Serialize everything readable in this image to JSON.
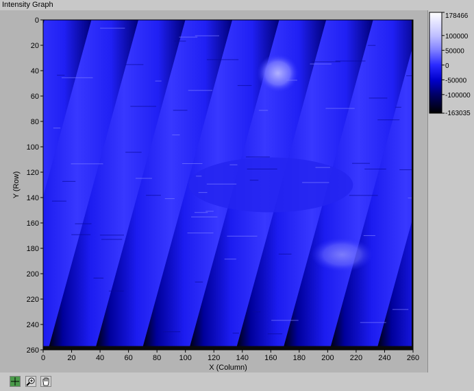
{
  "window": {
    "title": "Intensity Graph"
  },
  "chart_data": {
    "type": "heatmap",
    "title": "Intensity Graph",
    "xlabel": "X (Column)",
    "ylabel": "Y (Row)",
    "xlim": [
      0,
      260
    ],
    "ylim": [
      0,
      260
    ],
    "y_inverted": true,
    "x_ticks": [
      0,
      20,
      40,
      60,
      80,
      100,
      120,
      140,
      160,
      180,
      200,
      220,
      240,
      260
    ],
    "y_ticks": [
      0,
      20,
      40,
      60,
      80,
      100,
      120,
      140,
      160,
      180,
      200,
      220,
      240,
      260
    ],
    "data_extent": {
      "x": [
        0,
        259
      ],
      "y": [
        0,
        257
      ]
    },
    "colorscale": {
      "min": -163035,
      "max": 178466,
      "ticks": [
        "178466",
        "100000",
        "50000",
        "0",
        "-50000",
        "-100000",
        "-163035"
      ],
      "stops": [
        {
          "value": -163035,
          "color": "#000000"
        },
        {
          "value": -100000,
          "color": "#000066"
        },
        {
          "value": -50000,
          "color": "#0000cc"
        },
        {
          "value": 0,
          "color": "#2a2aff"
        },
        {
          "value": 50000,
          "color": "#7f7fff"
        },
        {
          "value": 100000,
          "color": "#c0c0ff"
        },
        {
          "value": 178466,
          "color": "#ffffff"
        }
      ]
    },
    "stripe_count": 11,
    "stripe_spacing_columns": 33,
    "stripe_tilt_columns_per_row": 0.24,
    "baseline_value": -15000,
    "dark_trough_value": -135000,
    "bright_region_value": 75000
  },
  "toolbar": {
    "tools": [
      "cursor-tool",
      "zoom-tool",
      "pan-tool"
    ]
  }
}
